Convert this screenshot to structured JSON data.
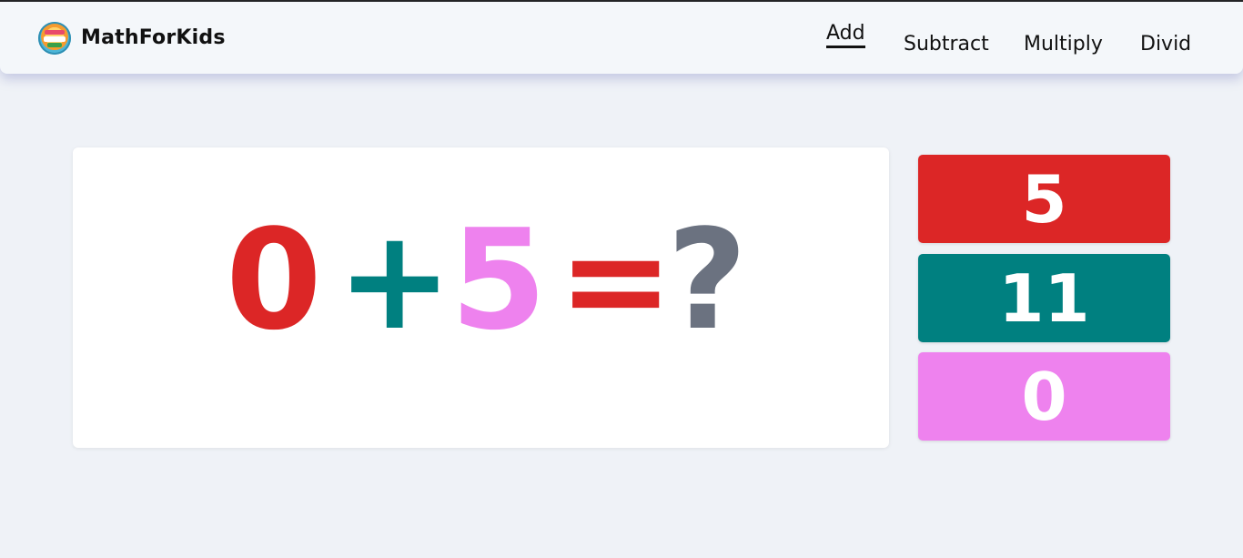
{
  "brand": {
    "name": "MathForKids",
    "logo_icon": "math-for-kids-logo-icon"
  },
  "nav": {
    "items": [
      {
        "label": "Add",
        "active": true
      },
      {
        "label": "Subtract",
        "active": false
      },
      {
        "label": "Multiply",
        "active": false
      },
      {
        "label": "Divid",
        "active": false
      }
    ]
  },
  "equation": {
    "operand1": "0",
    "operator": "+",
    "operand2": "5",
    "equals": "=",
    "unknown": "?"
  },
  "answers": [
    {
      "value": "5",
      "color": "#dc2626"
    },
    {
      "value": "11",
      "color": "#008080"
    },
    {
      "value": "0",
      "color": "#ee82ee"
    }
  ],
  "colors": {
    "red": "#dc2626",
    "teal": "#008080",
    "violet": "#ee82ee",
    "gray": "#6b7280",
    "background": "#eff2f7"
  }
}
